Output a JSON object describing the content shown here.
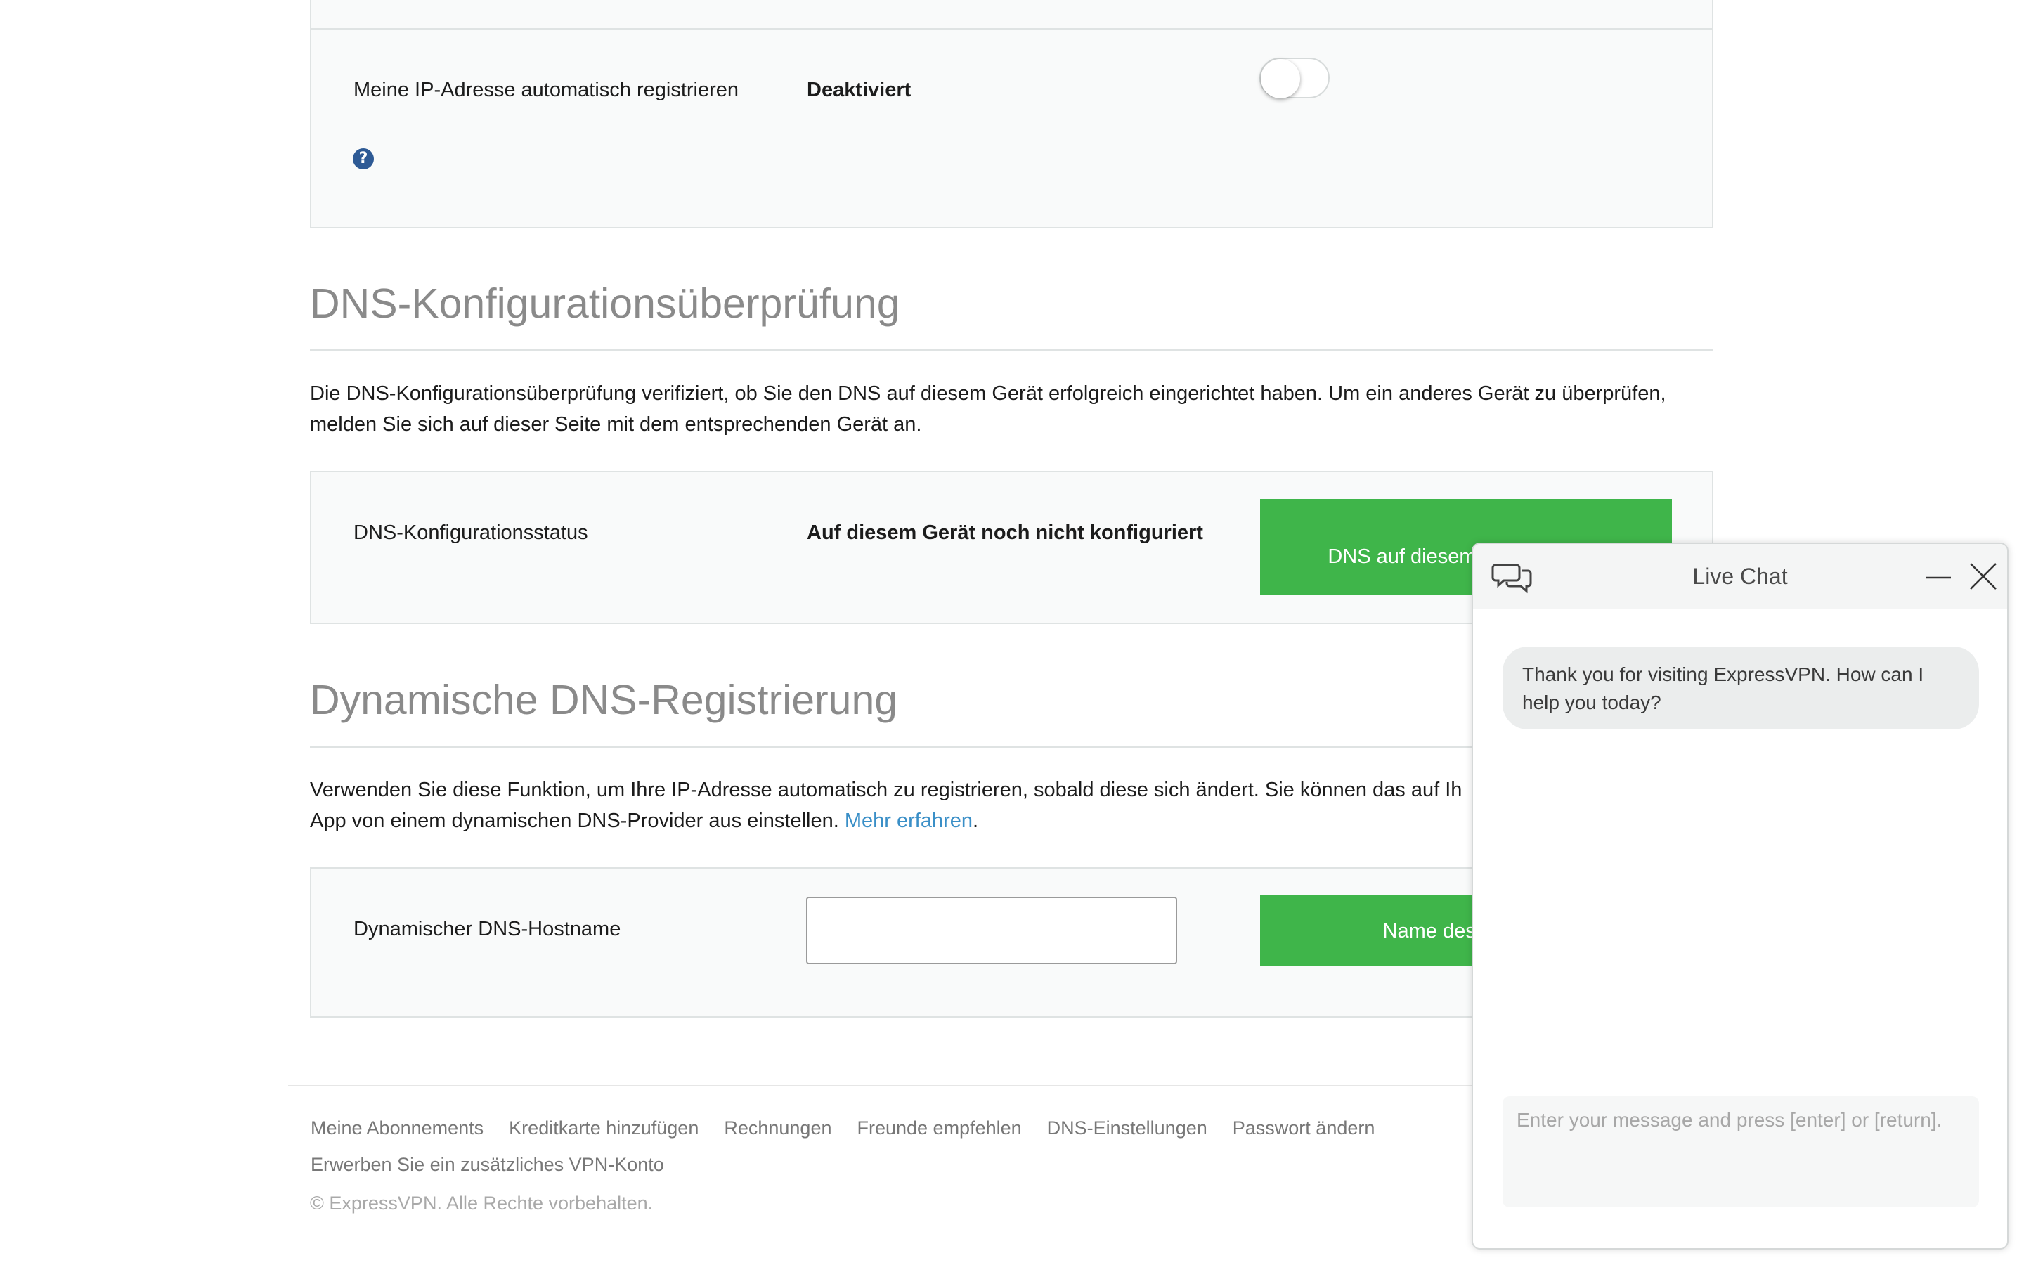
{
  "ip_registration": {
    "label": "Meine IP-Adresse automatisch registrieren",
    "status": "Deaktiviert",
    "toggle_on": false,
    "help_icon": "question-circle-icon"
  },
  "dns_check": {
    "heading": "DNS-Konfigurationsüberprüfung",
    "description": "Die DNS-Konfigurationsüberprüfung verifiziert, ob Sie den DNS auf diesem Gerät erfolgreich eingerichtet haben. Um ein anderes Gerät zu überprüfen, melden Sie sich auf dieser Seite mit dem entsprechenden Gerät an.",
    "status_label": "DNS-Konfigurationsstatus",
    "status_value": "Auf diesem Gerät noch nicht konfiguriert",
    "button_label": "DNS auf diesem Gerät konfigu"
  },
  "dynamic_dns": {
    "heading": "Dynamische DNS-Registrierung",
    "description_before_link": "Verwenden Sie diese Funktion, um Ihre IP-Adresse automatisch zu registrieren, sobald diese sich ändert. Sie können das auf Ih",
    "description_line2": "App von einem dynamischen DNS-Provider aus einstellen.",
    "link_text": "Mehr erfahren",
    "after_link": ".",
    "hostname_label": "Dynamischer DNS-Hostname",
    "hostname_value": "",
    "button_label": "Name des Hosts s"
  },
  "footer": {
    "links": [
      "Meine Abonnements",
      "Kreditkarte hinzufügen",
      "Rechnungen",
      "Freunde empfehlen",
      "DNS-Einstellungen",
      "Passwort ändern"
    ],
    "extra_link": "Erwerben Sie ein zusätzliches VPN-Konto",
    "copyright": "© ExpressVPN. Alle Rechte vorbehalten."
  },
  "live_chat": {
    "title": "Live Chat",
    "message": "Thank you for visiting ExpressVPN. How can I help you today?",
    "input_placeholder": "Enter your message and press [enter] or [return].",
    "chat_icon": "chat-bubbles-icon",
    "minimize_icon": "minimize-icon",
    "close_icon": "close-icon"
  },
  "colors": {
    "accent_green": "#3fb54a",
    "link_blue": "#3a8fc7",
    "help_icon_blue": "#2e5a95"
  }
}
